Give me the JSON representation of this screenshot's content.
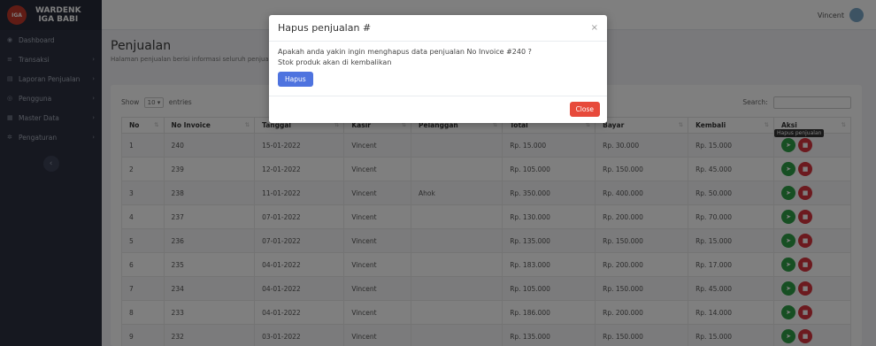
{
  "brand": {
    "line1": "WARDENK",
    "line2": "IGA BABI",
    "logo_text": "IGA"
  },
  "sidebar": {
    "items": [
      {
        "label": "Dashboard",
        "icon": "gauge-icon",
        "glyph": "◉",
        "chevron": ""
      },
      {
        "label": "Transaksi",
        "icon": "list-icon",
        "glyph": "≡",
        "chevron": "›"
      },
      {
        "label": "Laporan Penjualan",
        "icon": "report-icon",
        "glyph": "▤",
        "chevron": "›"
      },
      {
        "label": "Pengguna",
        "icon": "users-icon",
        "glyph": "◎",
        "chevron": "›"
      },
      {
        "label": "Master Data",
        "icon": "database-icon",
        "glyph": "▦",
        "chevron": "›"
      },
      {
        "label": "Pengaturan",
        "icon": "gear-icon",
        "glyph": "✲",
        "chevron": "›"
      }
    ],
    "collapse_glyph": "‹"
  },
  "topbar": {
    "user_name": "Vincent"
  },
  "page": {
    "title": "Penjualan",
    "subtitle": "Halaman penjualan berisi informasi seluruh penjualan"
  },
  "datatable": {
    "show_label": "Show",
    "length_value": "10",
    "entries_label": "entries",
    "search_label": "Search:",
    "columns": [
      "No",
      "No Invoice",
      "Tanggal",
      "Kasir",
      "Pelanggan",
      "Total",
      "Bayar",
      "Kembali",
      "Aksi"
    ],
    "rows": [
      [
        "1",
        "240",
        "15-01-2022",
        "Vincent",
        "",
        "Rp. 15.000",
        "Rp. 30.000",
        "Rp. 15.000"
      ],
      [
        "2",
        "239",
        "12-01-2022",
        "Vincent",
        "",
        "Rp. 105.000",
        "Rp. 150.000",
        "Rp. 45.000"
      ],
      [
        "3",
        "238",
        "11-01-2022",
        "Vincent",
        "Ahok",
        "Rp. 350.000",
        "Rp. 400.000",
        "Rp. 50.000"
      ],
      [
        "4",
        "237",
        "07-01-2022",
        "Vincent",
        "",
        "Rp. 130.000",
        "Rp. 200.000",
        "Rp. 70.000"
      ],
      [
        "5",
        "236",
        "07-01-2022",
        "Vincent",
        "",
        "Rp. 135.000",
        "Rp. 150.000",
        "Rp. 15.000"
      ],
      [
        "6",
        "235",
        "04-01-2022",
        "Vincent",
        "",
        "Rp. 183.000",
        "Rp. 200.000",
        "Rp. 17.000"
      ],
      [
        "7",
        "234",
        "04-01-2022",
        "Vincent",
        "",
        "Rp. 105.000",
        "Rp. 150.000",
        "Rp. 45.000"
      ],
      [
        "8",
        "233",
        "04-01-2022",
        "Vincent",
        "",
        "Rp. 186.000",
        "Rp. 200.000",
        "Rp. 14.000"
      ],
      [
        "9",
        "232",
        "03-01-2022",
        "Vincent",
        "",
        "Rp. 135.000",
        "Rp. 150.000",
        "Rp. 15.000"
      ]
    ]
  },
  "tooltip": {
    "text": "Hapus penjualan"
  },
  "modal": {
    "title": "Hapus penjualan #",
    "close_glyph": "×",
    "message_line1": "Apakah anda yakin ingin menghapus data penjualan No Invoice #240 ?",
    "message_line2": "Stok produk akan di kembalikan",
    "confirm_label": "Hapus",
    "close_label": "Close"
  },
  "colors": {
    "sidebar": "#2c3141",
    "primary": "#4e73df",
    "danger": "#e74a3b",
    "success": "#2e9e47"
  }
}
